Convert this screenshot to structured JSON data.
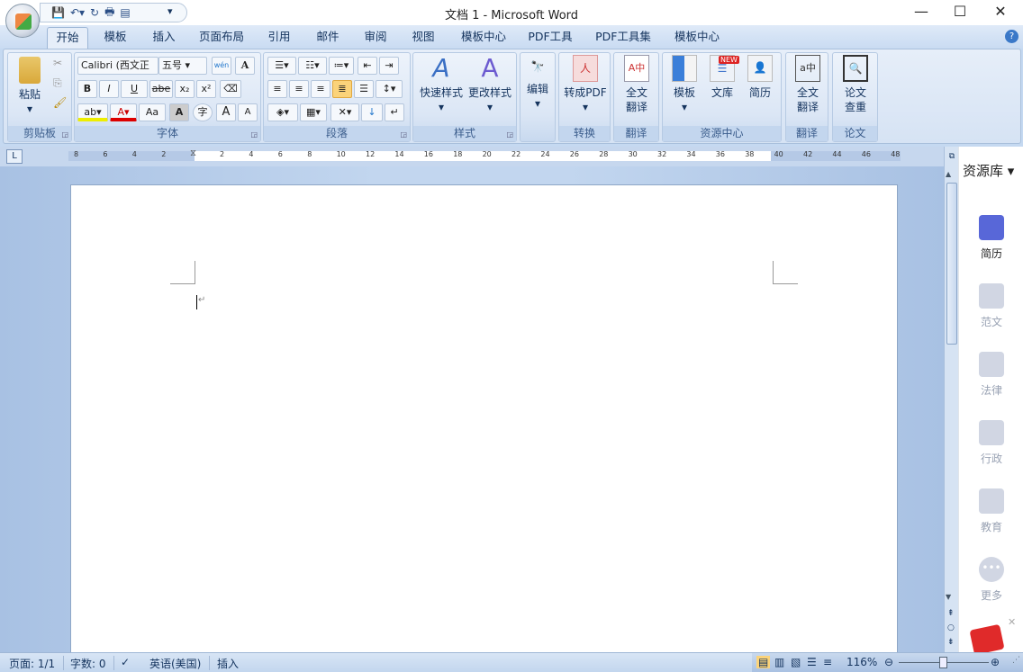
{
  "window": {
    "title": "文档 1 - Microsoft Word"
  },
  "qat": {
    "more": "▾"
  },
  "tabs": [
    "开始",
    "模板",
    "插入",
    "页面布局",
    "引用",
    "邮件",
    "审阅",
    "视图",
    "模板中心",
    "PDF工具",
    "PDF工具集",
    "模板中心"
  ],
  "ribbon": {
    "clipboard": {
      "label": "剪贴板",
      "paste": "粘贴"
    },
    "font": {
      "label": "字体",
      "font_name": "Calibri (西文正",
      "font_size": "五号",
      "bold": "B",
      "italic": "I",
      "underline": "U",
      "strike": "abe",
      "sub": "x₂",
      "sup": "x²",
      "case": "Aa",
      "grow": "A",
      "shrink": "A",
      "char_shade": "A",
      "enclose": "字",
      "phonetic": "wén",
      "border": "A"
    },
    "paragraph": {
      "label": "段落"
    },
    "styles": {
      "label": "样式",
      "quick": "快速样式",
      "change": "更改样式"
    },
    "edit": {
      "label": "编辑"
    },
    "convert": {
      "label": "转换",
      "pdf": "转成PDF"
    },
    "translate1": {
      "label": "翻译",
      "full": "全文",
      "full2": "翻译"
    },
    "resources": {
      "label": "资源中心",
      "template": "模板",
      "library": "文库",
      "resume": "简历",
      "new_badge": "NEW"
    },
    "translate2": {
      "label": "翻译",
      "full": "全文",
      "full2": "翻译"
    },
    "thesis": {
      "label": "论文",
      "check": "论文",
      "check2": "查重"
    }
  },
  "ruler": {
    "ticks": [
      "8",
      "6",
      "4",
      "2",
      "",
      "2",
      "4",
      "6",
      "8",
      "10",
      "12",
      "14",
      "16",
      "18",
      "20",
      "22",
      "24",
      "26",
      "28",
      "30",
      "32",
      "34",
      "36",
      "38",
      "40",
      "42",
      "44",
      "46",
      "48"
    ]
  },
  "side_panel": {
    "title": "资源库",
    "items": [
      "简历",
      "范文",
      "法律",
      "行政",
      "教育",
      "更多"
    ]
  },
  "status": {
    "page": "页面: 1/1",
    "words": "字数: 0",
    "language": "英语(美国)",
    "mode": "插入",
    "zoom": "116%"
  }
}
